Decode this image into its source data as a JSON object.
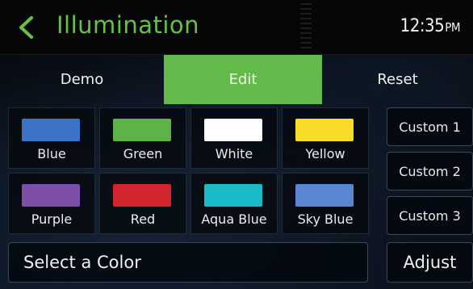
{
  "header": {
    "title": "Illumination",
    "time": "12:35",
    "ampm": "PM",
    "accent_color": "#63c343"
  },
  "tabs": [
    {
      "label": "Demo",
      "active": false
    },
    {
      "label": "Edit",
      "active": true
    },
    {
      "label": "Reset",
      "active": false
    }
  ],
  "colors": [
    {
      "label": "Blue",
      "hex": "#3b73c6"
    },
    {
      "label": "Green",
      "hex": "#5cb449"
    },
    {
      "label": "White",
      "hex": "#ffffff"
    },
    {
      "label": "Yellow",
      "hex": "#f8dc27"
    },
    {
      "label": "Purple",
      "hex": "#7e4fa8"
    },
    {
      "label": "Red",
      "hex": "#d3252d"
    },
    {
      "label": "Aqua Blue",
      "hex": "#1cb9c6"
    },
    {
      "label": "Sky Blue",
      "hex": "#5a86d1"
    }
  ],
  "custom": [
    {
      "label": "Custom 1"
    },
    {
      "label": "Custom 2"
    },
    {
      "label": "Custom 3"
    }
  ],
  "footer": {
    "status": "Select a Color",
    "adjust_label": "Adjust"
  }
}
